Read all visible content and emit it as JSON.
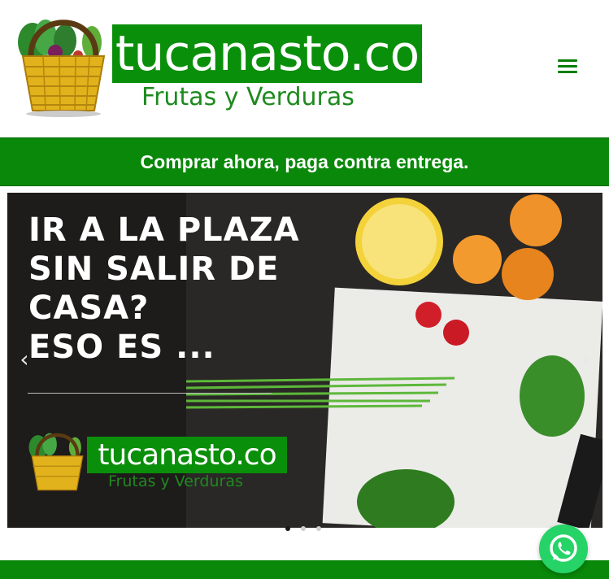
{
  "header": {
    "brand_name": "tucanasto.co",
    "tagline": "Frutas y Verduras",
    "menu_icon": "hamburger-menu-icon"
  },
  "promo": {
    "text": "Comprar ahora, paga contra entrega."
  },
  "slider": {
    "title": "IR A LA PLAZA\nSIN SALIR DE\nCASA?\nESO ES ...",
    "logo_brand": "tucanasto.co",
    "logo_tagline": "Frutas y Verduras",
    "prev_label": "‹",
    "next_label": "›",
    "dots_count": 3,
    "active_dot": 1
  },
  "whatsapp": {
    "icon": "whatsapp-icon",
    "color": "#25d366"
  },
  "colors": {
    "brand_green": "#0a8f0a",
    "banner_green": "#098809"
  }
}
